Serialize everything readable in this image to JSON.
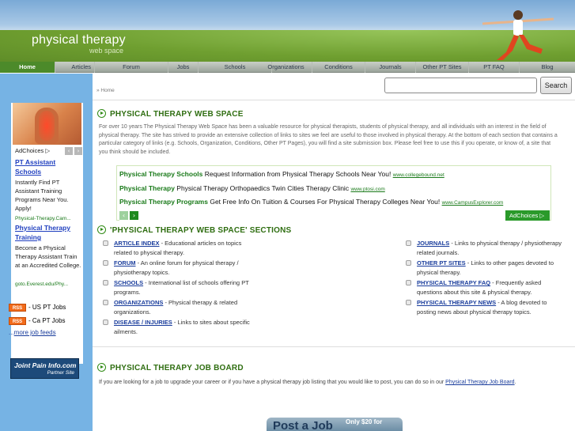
{
  "header": {
    "site_title": "physical therapy",
    "site_subtitle": "web space"
  },
  "nav": {
    "items": [
      {
        "label": "Home",
        "active": true
      },
      {
        "label": "Articles"
      },
      {
        "label": "Forum"
      },
      {
        "label": "Jobs"
      },
      {
        "label": "Schools"
      },
      {
        "label": "Organizations"
      },
      {
        "label": "Conditions"
      },
      {
        "label": "Journals"
      },
      {
        "label": "Other PT Sites"
      },
      {
        "label": "PT FAQ"
      },
      {
        "label": "Blog"
      }
    ]
  },
  "search": {
    "placeholder": "",
    "button_label": "Search"
  },
  "breadcrumb": "» Home",
  "sidebar": {
    "ad": {
      "adchoices_label": "AdChoices ▷",
      "prev_arrow": "‹",
      "next_arrow": "›",
      "ad1": {
        "title": "PT Assistant Schools",
        "text": "Instantly Find PT Assistant Training Programs Near You. Apply!",
        "url": "Physical-Therapy.Cam..."
      },
      "ad2": {
        "title": "Physical Therapy Training",
        "text": "Become a Physical Therapy Assistant Train at an Accredited College.",
        "url": "goto.Everest.edu/Phy..."
      }
    },
    "rss_badge": "RSS",
    "rss_feeds": [
      "- US PT Jobs",
      "- Ca PT Jobs"
    ],
    "more_feeds_prefix": "...",
    "more_feeds_link": "more job feeds",
    "partner": {
      "line1": "Joint Pain Info.com",
      "line2": "Partner Site"
    }
  },
  "main": {
    "section1": {
      "heading": "PHYSICAL THERAPY WEB SPACE",
      "intro": "For over 10 years The Physical Therapy Web Space has been a valuable resource for physical therapists, students of physical therapy, and all individuals with an interest in the field of physical therapy. The site has strived to provide an extensive collection of links to sites we feel are useful to those involved in physical therapy. At the bottom of each section that contains a particular category of links (e.g. Schools, Organization, Conditions, Other PT Pages), you will find a site submission box. Please feel free to use this if you operate, or know of, a site that you think should be included."
    },
    "ad_strip": {
      "items": [
        {
          "title": "Physical Therapy Schools",
          "text": " Request Information from Physical Therapy Schools Near You! ",
          "url": "www.collegebound.net"
        },
        {
          "title": "Physical Therapy",
          "text": " Physical Therapy Orthopaedics Twin Cities Therapy Clinic ",
          "url": "www.ptosi.com"
        },
        {
          "title": "Physical Therapy Programs",
          "text": " Get Free Info On Tuition & Courses For Physical Therapy Colleges Near You! ",
          "url": "www.CampusExplorer.com"
        }
      ],
      "prev_arrow": "‹",
      "next_arrow": "›",
      "adchoices_label": "AdChoices ▷"
    },
    "section2": {
      "heading": "'PHYSICAL THERAPY WEB SPACE' SECTIONS",
      "left": [
        {
          "link": "ARTICLE INDEX",
          "desc": " - Educational articles on topics related to physical therapy."
        },
        {
          "link": "FORUM",
          "desc": " - An online forum for physical therapy / physiotherapy topics."
        },
        {
          "link": "SCHOOLS",
          "desc": " - International list of schools offering PT programs."
        },
        {
          "link": "ORGANIZATIONS",
          "desc": " - Physical therapy & related organizations."
        },
        {
          "link": "DISEASE / INJURIES",
          "desc": " - Links to sites about specific ailments."
        }
      ],
      "right": [
        {
          "link": "JOURNALS",
          "desc": " - Links to physical therapy / physiotherapy related journals."
        },
        {
          "link": "OTHER PT SITES",
          "desc": " - Links to other pages devoted to physical therapy."
        },
        {
          "link": "PHYSICAL THERAPY FAQ",
          "desc": " - Frequently asked questions about this site & physical therapy."
        },
        {
          "link": "PHYSICAL THERAPY NEWS",
          "desc": " - A blog devoted to posting news about physical therapy topics."
        }
      ]
    },
    "section3": {
      "heading": "PHYSICAL THERAPY JOB BOARD",
      "text": "If you are looking for a job to upgrade your career or if you have a physical therapy job listing that you would like to post, you can do so in our ",
      "link": "Physical Therapy Job Board",
      "suffix": ".",
      "post_job": "Post a Job",
      "post_job_price": "Only $20 for"
    }
  },
  "colors": {
    "sidebar_bg": "#76b3e4",
    "heading_green": "#2f6e11",
    "link_blue": "#1a3d9c",
    "nav_active": "#4c8a2a",
    "rss_orange": "#f26b1a"
  }
}
